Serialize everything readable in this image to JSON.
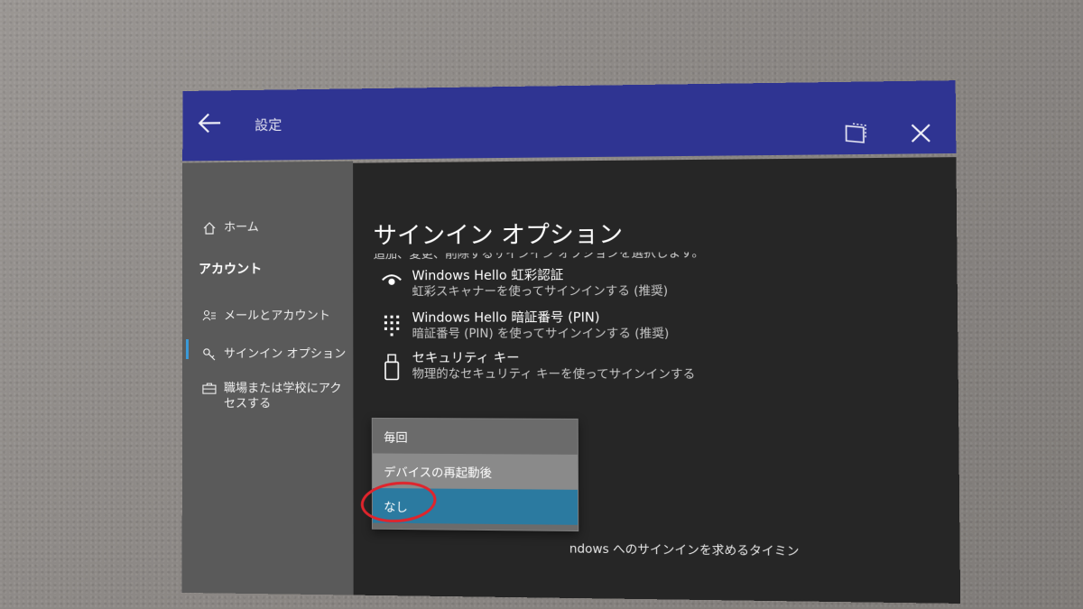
{
  "window": {
    "title": "設定",
    "back_icon": "back-arrow-icon",
    "snap_icon": "snap-window-icon",
    "close_icon": "close-icon"
  },
  "sidebar": {
    "home_label": "ホーム",
    "section_heading": "アカウント",
    "items": [
      {
        "label": "メールとアカウント",
        "icon": "mail-accounts-icon"
      },
      {
        "label": "サインイン オプション",
        "icon": "key-icon",
        "active": true
      },
      {
        "label": "職場または学校にアクセスする",
        "icon": "briefcase-icon"
      }
    ]
  },
  "main": {
    "title": "サインイン オプション",
    "subtitle": "追加、変更、削除するサインイン オプションを選択します。",
    "options": [
      {
        "name": "Windows Hello 虹彩認証",
        "description": "虹彩スキャナーを使ってサインインする (推奨)",
        "icon": "eye-icon"
      },
      {
        "name": "Windows Hello 暗証番号 (PIN)",
        "description": "暗証番号 (PIN) を使ってサインインする (推奨)",
        "icon": "keypad-icon"
      },
      {
        "name": "セキュリティ キー",
        "description": "物理的なセキュリティ キーを使ってサインインする",
        "icon": "usb-key-icon"
      }
    ],
    "require_signin_text": "ndows へのサインインを求めるタイミン"
  },
  "dropdown": {
    "options": [
      "毎回",
      "デバイスの再起動後",
      "なし"
    ],
    "selected": "なし"
  },
  "colors": {
    "titlebar": "#2f3492",
    "sidebar": "#5a5a5a",
    "content": "#262626",
    "accent": "#2b7aa0",
    "annotation_ring": "#e0242c"
  }
}
